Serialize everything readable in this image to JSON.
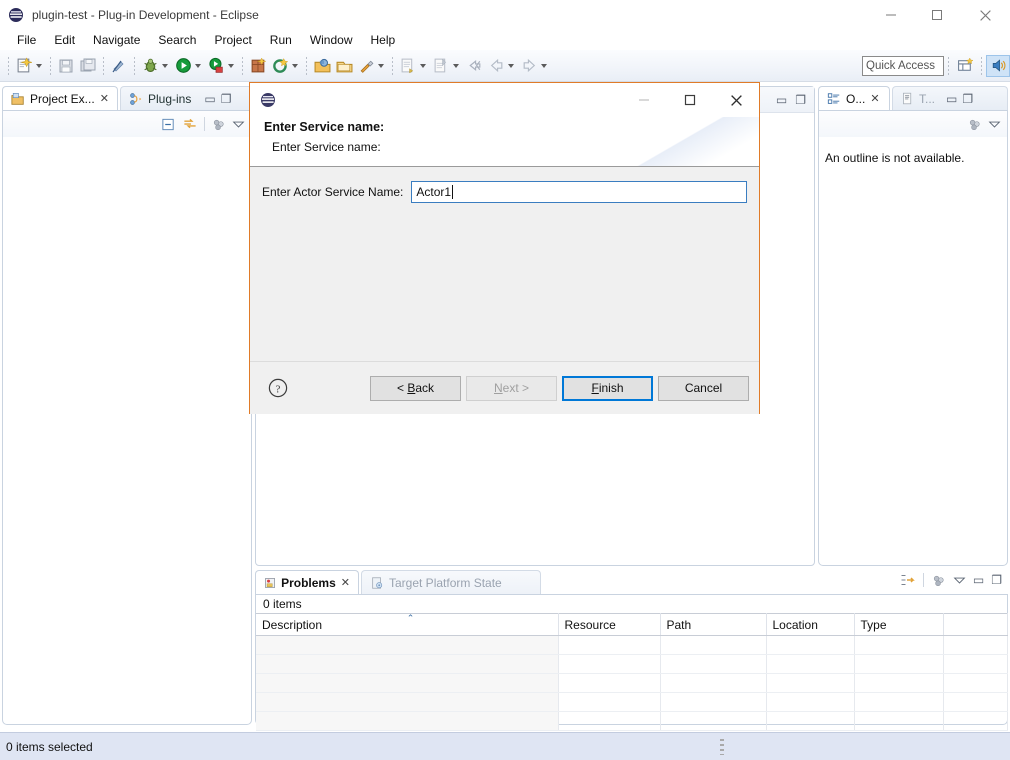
{
  "window": {
    "title": "plugin-test - Plug-in Development - Eclipse",
    "app_icon": "eclipse-icon",
    "controls": {
      "minimize": "—",
      "maximize": "□",
      "close": "✕"
    }
  },
  "menubar": {
    "items": [
      "File",
      "Edit",
      "Navigate",
      "Search",
      "Project",
      "Run",
      "Window",
      "Help"
    ]
  },
  "toolbar": {
    "quick_access_placeholder": "Quick Access",
    "buttons": [
      "new-wizard",
      "save",
      "save-all",
      "toggle-mark-occurrences",
      "debug",
      "run",
      "run-coverage",
      "new-plugin-project",
      "new-java-class",
      "open-type",
      "open-task",
      "external-tools",
      "next-annotation",
      "previous-annotation",
      "back",
      "forward"
    ],
    "perspective_buttons": [
      "open-perspective",
      "java-perspective"
    ]
  },
  "left_view": {
    "tabs": [
      {
        "label": "Project Ex...",
        "icon": "project-explorer-icon",
        "active": true,
        "closable": true
      },
      {
        "label": "Plug-ins",
        "icon": "plugins-icon",
        "active": false,
        "closable": false
      }
    ],
    "view_actions": [
      "collapse-all-icon",
      "link-with-editor-icon",
      "view-menu-icon",
      "minimize-icon"
    ]
  },
  "right_view": {
    "tabs": [
      {
        "label": "O...",
        "icon": "outline-icon",
        "active": true,
        "closable": true
      },
      {
        "label": "T...",
        "icon": "task-list-icon",
        "active": false,
        "closable": false
      }
    ],
    "message": "An outline is not available."
  },
  "problems_view": {
    "tabs": [
      {
        "label": "Problems",
        "icon": "problems-icon",
        "active": true,
        "closable": true
      },
      {
        "label": "Target Platform State",
        "icon": "target-platform-icon",
        "active": false,
        "closable": false
      }
    ],
    "item_count_label": "0 items",
    "columns": [
      "Description",
      "Resource",
      "Path",
      "Location",
      "Type"
    ],
    "sorted_column": "Description",
    "sort_direction": "ascending",
    "rows": []
  },
  "statusbar": {
    "text": "0 items selected"
  },
  "dialog": {
    "icon": "eclipse-icon",
    "title_controls": {
      "minimize": "—",
      "maximize": "□",
      "close": "✕"
    },
    "heading": "Enter Service name:",
    "subheading": "Enter Service name:",
    "field": {
      "label": "Enter Actor Service Name:",
      "value": "Actor1",
      "placeholder": ""
    },
    "help_icon": "help-question-icon",
    "buttons": [
      {
        "label": "< Back",
        "mnemonic": "B",
        "state": "enabled"
      },
      {
        "label": "Next >",
        "mnemonic": "N",
        "state": "disabled"
      },
      {
        "label": "Finish",
        "mnemonic": "F",
        "state": "default"
      },
      {
        "label": "Cancel",
        "mnemonic": "",
        "state": "enabled"
      }
    ]
  },
  "colors": {
    "dialog_border": "#e07b28",
    "default_button_border": "#0078d7",
    "focus_field_border": "#3a7dc0",
    "statusbar_bg": "#dfe5f3"
  }
}
